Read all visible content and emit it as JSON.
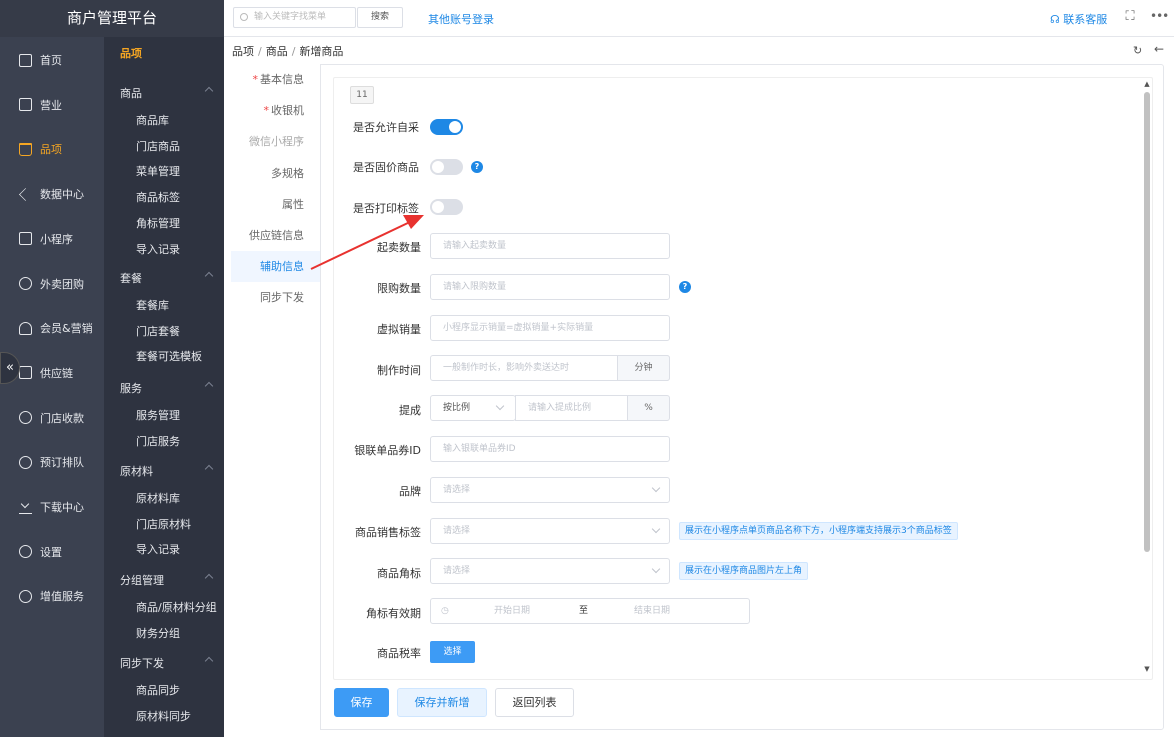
{
  "brand": "商户管理平台",
  "topbar": {
    "search_placeholder": "输入关键字找菜单",
    "search_button": "搜索",
    "other_login": "其他账号登录",
    "service": "联系客服",
    "fullscreen_icon": "expand-icon",
    "more_icon": "ellipsis-icon"
  },
  "sidebar_primary": [
    {
      "label": "首页",
      "icon": "home-icon"
    },
    {
      "label": "营业",
      "icon": "calendar-icon"
    },
    {
      "label": "品项",
      "icon": "bag-icon",
      "active": true
    },
    {
      "label": "数据中心",
      "icon": "share-icon"
    },
    {
      "label": "小程序",
      "icon": "phone-icon"
    },
    {
      "label": "外卖团购",
      "icon": "group-icon"
    },
    {
      "label": "会员&营销",
      "icon": "user-icon"
    },
    {
      "label": "供应链",
      "icon": "truck-icon"
    },
    {
      "label": "门店收款",
      "icon": "coin-icon"
    },
    {
      "label": "预订排队",
      "icon": "clock-icon"
    },
    {
      "label": "下载中心",
      "icon": "download-icon"
    },
    {
      "label": "设置",
      "icon": "gear-icon"
    },
    {
      "label": "增值服务",
      "icon": "alarm-icon"
    }
  ],
  "sidebar_secondary": {
    "title": "品项",
    "groups": [
      {
        "label": "商品",
        "items": [
          "商品库",
          "门店商品",
          "菜单管理",
          "商品标签",
          "角标管理",
          "导入记录"
        ]
      },
      {
        "label": "套餐",
        "items": [
          "套餐库",
          "门店套餐",
          "套餐可选模板"
        ]
      },
      {
        "label": "服务",
        "items": [
          "服务管理",
          "门店服务"
        ]
      },
      {
        "label": "原材料",
        "items": [
          "原材料库",
          "门店原材料",
          "导入记录"
        ]
      },
      {
        "label": "分组管理",
        "items": [
          "商品/原材料分组",
          "财务分组"
        ]
      },
      {
        "label": "同步下发",
        "items": [
          "商品同步",
          "原材料同步"
        ]
      }
    ]
  },
  "collapse_icon": "«",
  "breadcrumb": [
    "品项",
    "商品",
    "新增商品"
  ],
  "breadcrumb_sep": "/",
  "tabs": [
    {
      "label": "基本信息",
      "required": true
    },
    {
      "label": "收银机",
      "required": true
    },
    {
      "label": "微信小程序",
      "muted": true
    },
    {
      "label": "多规格"
    },
    {
      "label": "属性"
    },
    {
      "label": "供应链信息"
    },
    {
      "label": "辅助信息",
      "active": true
    },
    {
      "label": "同步下发"
    }
  ],
  "form": {
    "badge": "11",
    "allow_self_purchase": {
      "label": "是否允许自采",
      "on": true
    },
    "fixed_price": {
      "label": "是否固价商品",
      "on": false
    },
    "print_label": {
      "label": "是否打印标签",
      "on": false
    },
    "min_qty": {
      "label": "起卖数量",
      "placeholder": "请输入起卖数量"
    },
    "limit_qty": {
      "label": "限购数量",
      "placeholder": "请输入限购数量"
    },
    "virtual_sales": {
      "label": "虚拟销量",
      "placeholder": "小程序显示销量=虚拟销量+实际销量"
    },
    "make_time": {
      "label": "制作时间",
      "placeholder": "一般制作时长，影响外卖送达时",
      "unit": "分钟"
    },
    "commission": {
      "label": "提成",
      "mode": "按比例",
      "placeholder": "请输入提成比例",
      "unit": "%"
    },
    "unionpay_id": {
      "label": "银联单品券ID",
      "placeholder": "输入银联单品券ID"
    },
    "brand": {
      "label": "品牌",
      "placeholder": "请选择"
    },
    "sales_tag": {
      "label": "商品销售标签",
      "placeholder": "请选择",
      "tip": "展示在小程序点单页商品名称下方，小程序端支持展示3个商品标签"
    },
    "corner": {
      "label": "商品角标",
      "placeholder": "请选择",
      "tip": "展示在小程序商品图片左上角"
    },
    "corner_period": {
      "label": "角标有效期",
      "start": "开始日期",
      "to": "至",
      "end": "结束日期"
    },
    "tax": {
      "label": "商品税率",
      "button": "选择"
    },
    "question_mark": "?"
  },
  "buttons": {
    "save": "保存",
    "save_new": "保存并新增",
    "back_list": "返回列表"
  },
  "annotation_color": "#e8322f",
  "accent_color": "#1e88e5"
}
